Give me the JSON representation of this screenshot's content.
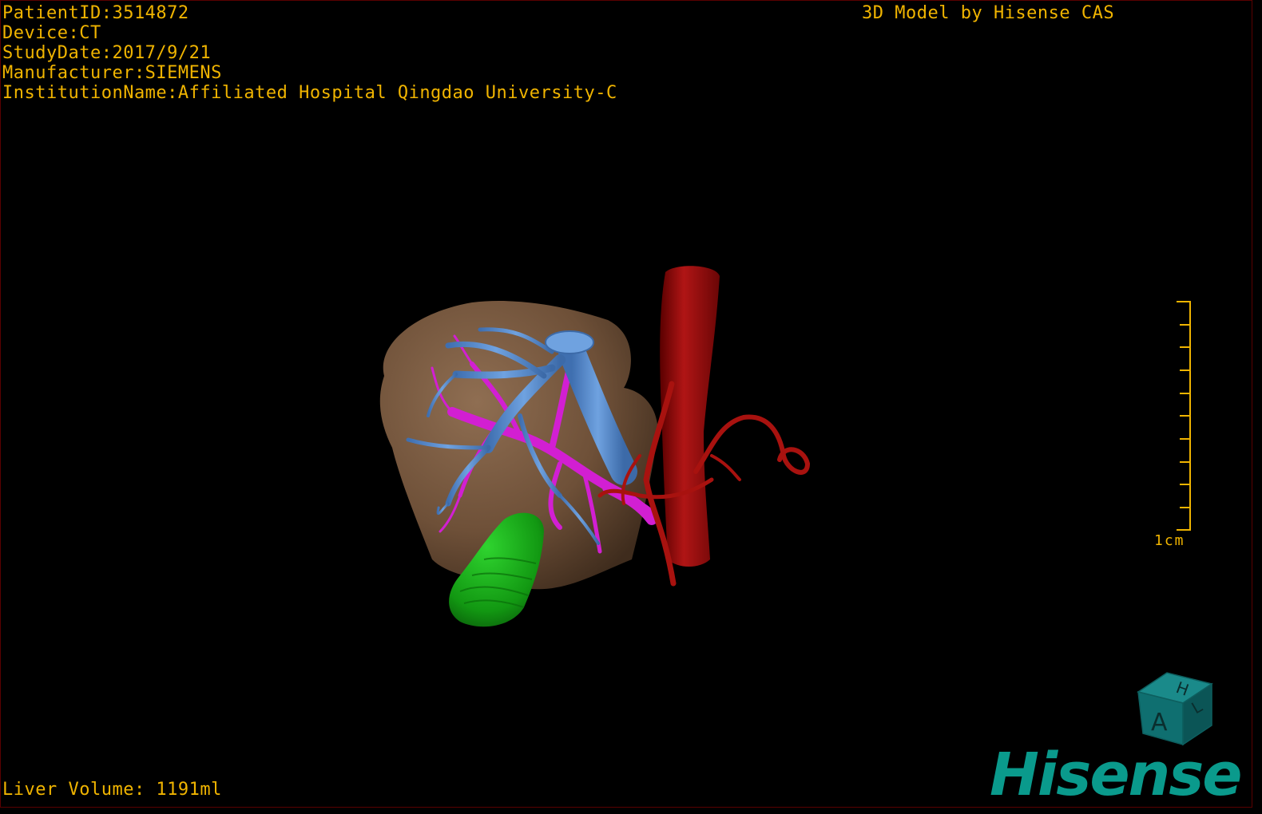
{
  "header": {
    "patient_id": "PatientID:3514872",
    "device": "Device:CT",
    "study_date": "StudyDate:2017/9/21",
    "manufacturer": "Manufacturer:SIEMENS",
    "institution": "InstitutionName:Affiliated Hospital Qingdao University-C",
    "brand_text": "3D Model by Hisense CAS"
  },
  "footer": {
    "liver_volume": "Liver Volume: 1191ml"
  },
  "scale": {
    "label": "1cm"
  },
  "orientation_cube": {
    "top_face": "H",
    "front_face": "A",
    "side_face": "L"
  },
  "logo": {
    "text": "Hisense"
  },
  "colors": {
    "overlay_text": "#f0b400",
    "liver": "#7a5a3e",
    "portal_vein": "#5b8fd1",
    "hepatic_vein": "#d21fd2",
    "aorta": "#a20f0f",
    "gallbladder": "#1bb51b",
    "logo": "#0a9a8c"
  }
}
